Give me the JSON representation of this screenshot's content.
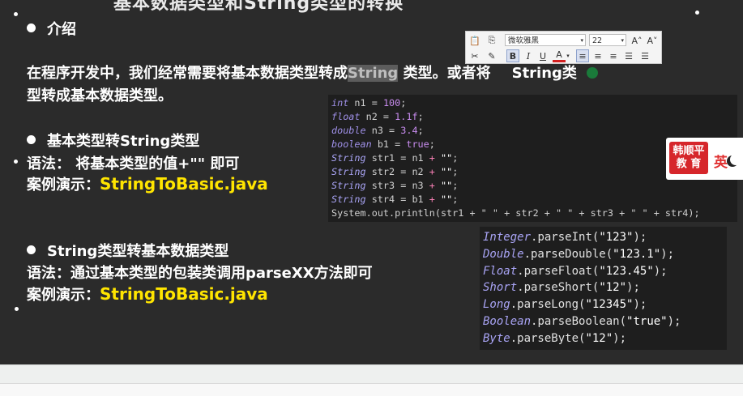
{
  "slide": {
    "title_fragment": "基本数据类型和String类型的转换",
    "intro_heading": "介绍",
    "intro_line1_a": "在程序开发中，我们经常需要将基本数据类型转成",
    "intro_line1_highlight": "String",
    "intro_line1_b": " 类型。或者将",
    "intro_line1_c": "String类",
    "intro_line2": "型转成基本数据类型。",
    "section1_heading": "基本类型转String类型",
    "section1_syntax": "语法： 将基本类型的值+\"\" 即可",
    "section1_demo_label": "案例演示：",
    "section1_demo_file": "StringToBasic.java",
    "section2_heading": "String类型转基本数据类型",
    "section2_syntax": "语法：通过基本类型的包装类调用parseXX方法即可",
    "section2_demo_label": "案例演示：",
    "section2_demo_file": "StringToBasic.java"
  },
  "code1": {
    "lines": [
      {
        "type": "int",
        "rest": " n1 = ",
        "val": "100",
        "end": ";"
      },
      {
        "type": "float",
        "rest": " n2 = ",
        "val": "1.1f",
        "end": ";"
      },
      {
        "type": "double",
        "rest": " n3 = ",
        "val": "3.4",
        "end": ";"
      },
      {
        "type": "boolean",
        "rest": " b1 = ",
        "val": "true",
        "end": ";"
      },
      {
        "type": "String",
        "rest": " str1 = n1 ",
        "op": "+",
        "str": " \"\"",
        "end": ";"
      },
      {
        "type": "String",
        "rest": " str2 = n2 ",
        "op": "+",
        "str": " \"\"",
        "end": ";"
      },
      {
        "type": "String",
        "rest": " str3 = n3 ",
        "op": "+",
        "str": " \"\"",
        "end": ";"
      },
      {
        "type": "String",
        "rest": " str4 = b1 ",
        "op": "+",
        "str": " \"\"",
        "end": ";"
      }
    ],
    "println": "System.out.println(str1 + \" \" + str2 + \" \" + str3 + \" \" + str4);"
  },
  "code2": {
    "lines": [
      {
        "cls": "Integer",
        "method": ".parseInt(",
        "arg": "\"123\"",
        "end": ");"
      },
      {
        "cls": "Double",
        "method": ".parseDouble(",
        "arg": "\"123.1\"",
        "end": ");"
      },
      {
        "cls": "Float",
        "method": ".parseFloat(",
        "arg": "\"123.45\"",
        "end": ");"
      },
      {
        "cls": "Short",
        "method": ".parseShort(",
        "arg": "\"12\"",
        "end": ");"
      },
      {
        "cls": "Long",
        "method": ".parseLong(",
        "arg": "\"12345\"",
        "end": ");"
      },
      {
        "cls": "Boolean",
        "method": ".parseBoolean(",
        "arg": "\"true\"",
        "end": ");"
      },
      {
        "cls": "Byte",
        "method": ".parseByte(",
        "arg": "\"12\"",
        "end": ");"
      }
    ]
  },
  "toolbar": {
    "font_name": "微软雅黑",
    "font_size": "22"
  },
  "logo": {
    "line1": "韩顺平",
    "line2": "教 育",
    "ime_label": "英"
  },
  "colors": {
    "slide_bg": "#2b2b2b",
    "highlight_yellow": "#ffe500",
    "keyword": "#9e8fe6",
    "operator": "#f77fb4",
    "logo_red": "#d6262b"
  }
}
